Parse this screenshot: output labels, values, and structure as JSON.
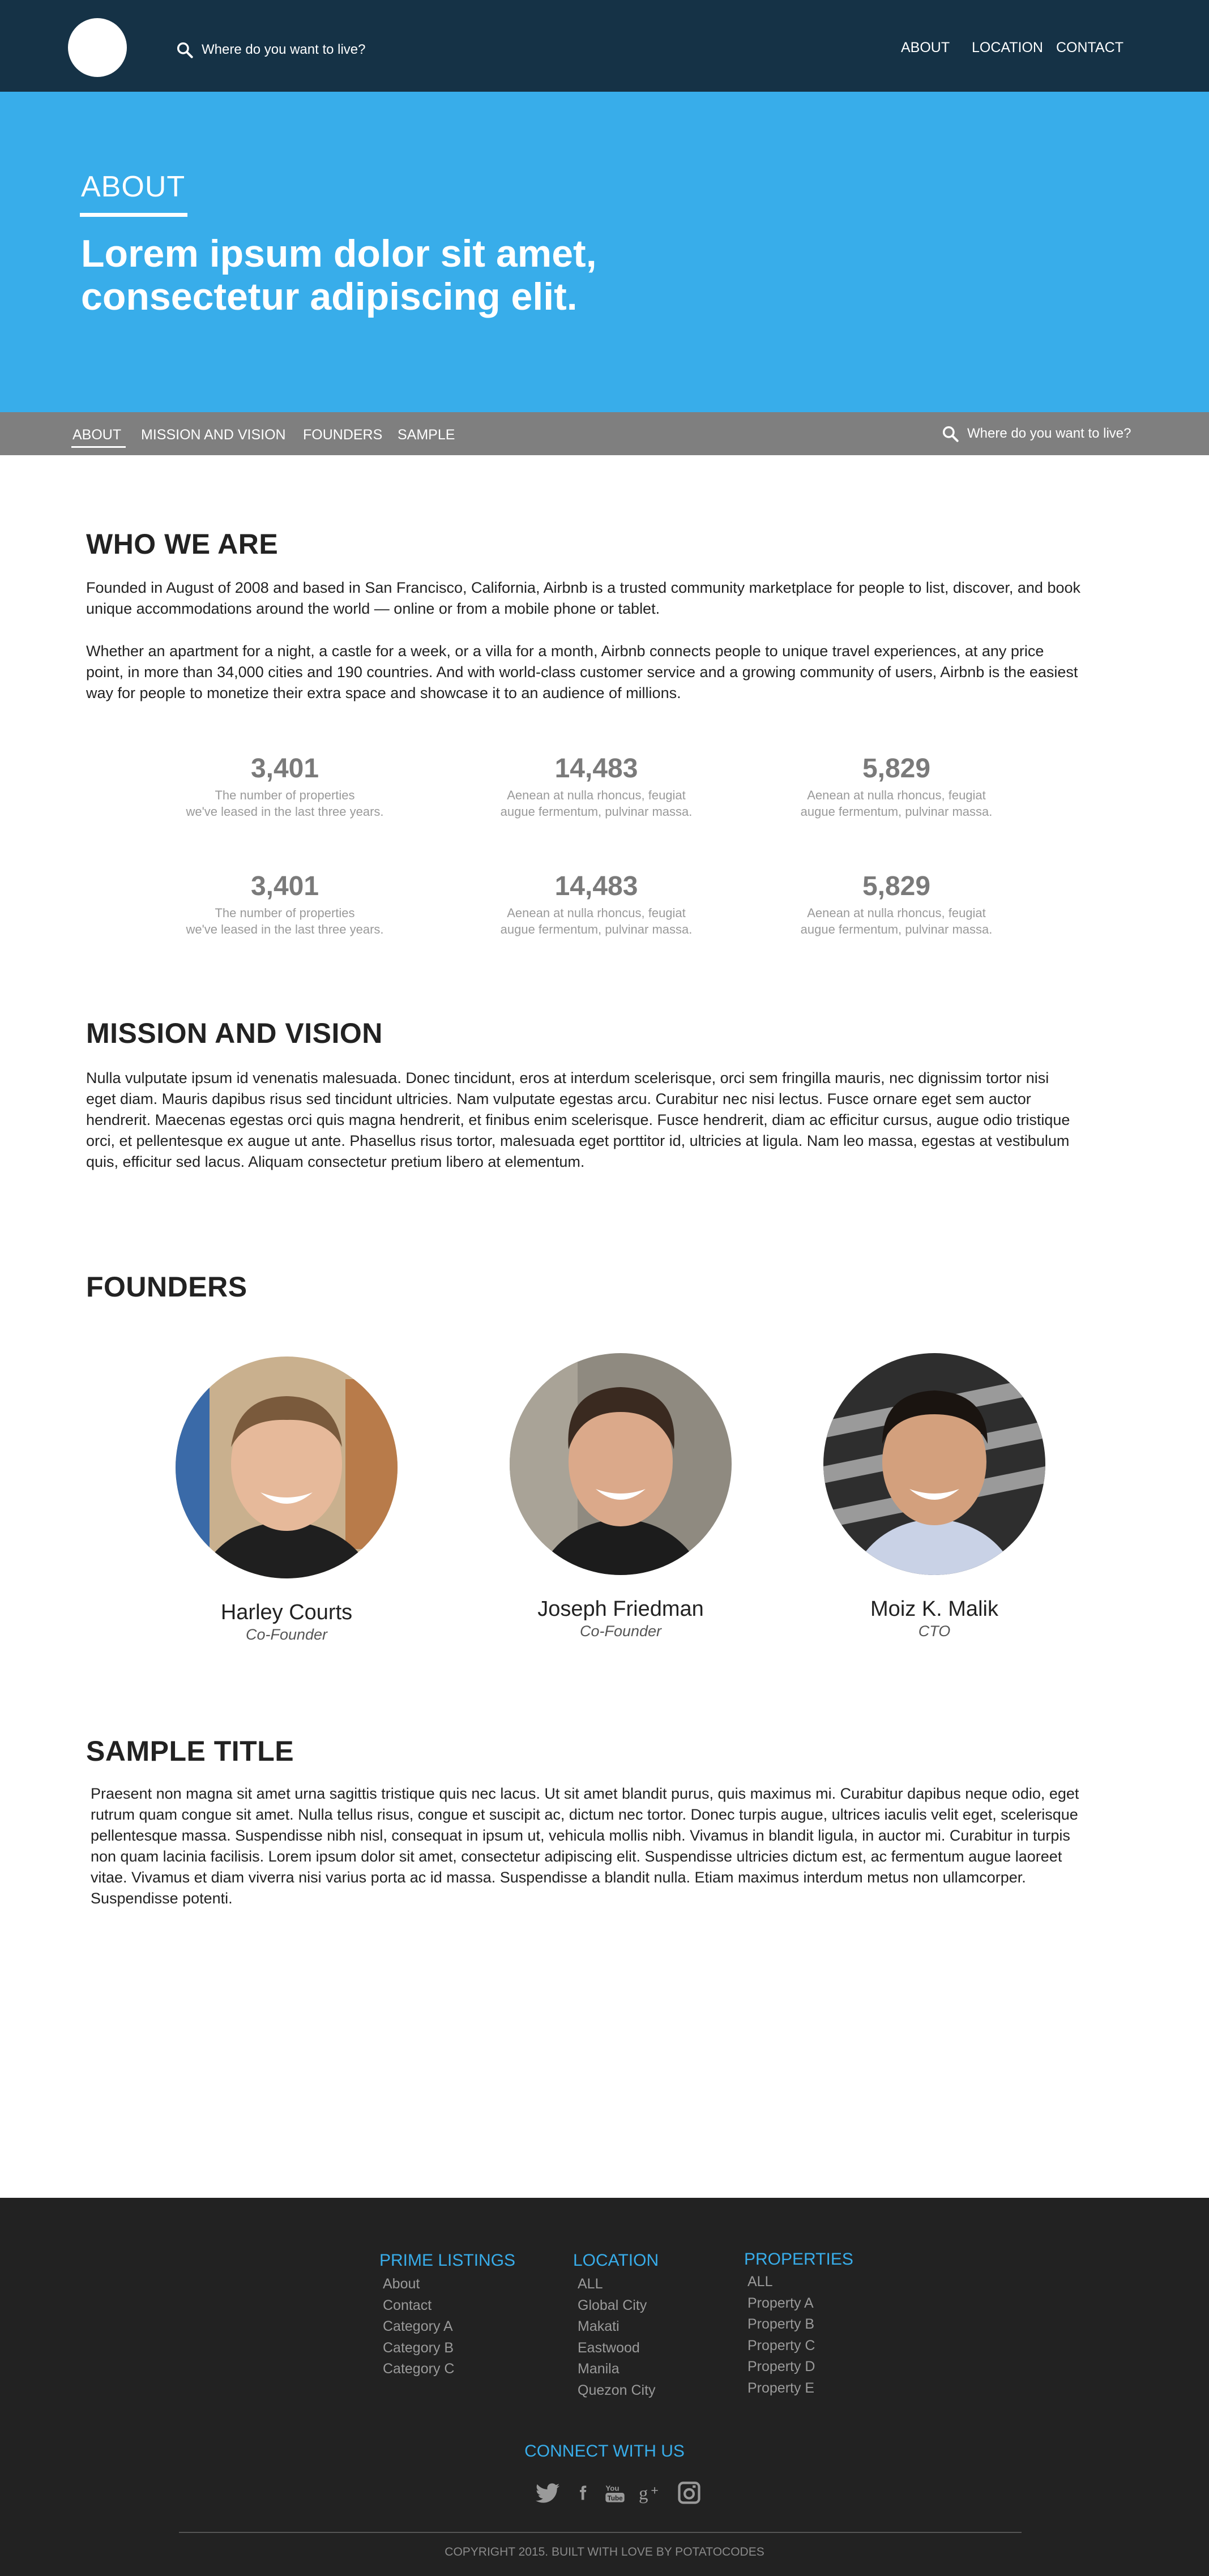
{
  "top_nav": {
    "search_placeholder": "Where do you want to live?",
    "links": [
      "ABOUT",
      "LOCATION",
      "CONTACT"
    ]
  },
  "hero": {
    "kicker": "ABOUT",
    "title_line1": "Lorem ipsum dolor sit amet,",
    "title_line2": "consectetur adipiscing elit."
  },
  "sub_nav": {
    "links": [
      "ABOUT",
      "MISSION AND VISION",
      "FOUNDERS",
      "SAMPLE"
    ],
    "search_placeholder": "Where do you want to live?"
  },
  "who_we_are": {
    "title": "WHO WE ARE",
    "paragraphs": [
      "Founded in August of 2008 and based in San Francisco, California, Airbnb is a trusted community marketplace for people to list, discover, and book unique accommodations around the world — online or from a mobile phone or tablet.",
      "Whether an apartment for a night, a castle for a week, or a villa for a month, Airbnb connects people to unique travel experiences, at any price point, in more than 34,000 cities and 190 countries. And with world-class customer service and a growing community of users, Airbnb is the easiest way for people to monetize their extra space and showcase it to an audience of millions."
    ],
    "stats": [
      {
        "value": "3,401",
        "line1": "The number of properties",
        "line2": "we've leased in the last three years."
      },
      {
        "value": "14,483",
        "line1": "Aenean at nulla rhoncus, feugiat",
        "line2": "augue fermentum, pulvinar massa."
      },
      {
        "value": "5,829",
        "line1": "Aenean at nulla rhoncus, feugiat",
        "line2": "augue fermentum, pulvinar massa."
      },
      {
        "value": "3,401",
        "line1": "The number of properties",
        "line2": "we've leased in the last three years."
      },
      {
        "value": "14,483",
        "line1": "Aenean at nulla rhoncus, feugiat",
        "line2": "augue fermentum, pulvinar massa."
      },
      {
        "value": "5,829",
        "line1": "Aenean at nulla rhoncus, feugiat",
        "line2": "augue fermentum, pulvinar massa."
      }
    ]
  },
  "mission": {
    "title": "MISSION AND VISION",
    "text": "Nulla vulputate ipsum id venenatis malesuada. Donec tincidunt, eros at interdum scelerisque, orci sem fringilla mauris, nec dignissim tortor nisi eget diam. Mauris dapibus risus sed tincidunt ultricies. Nam vulputate egestas arcu. Curabitur nec nisi lectus. Fusce ornare eget sem auctor hendrerit. Maecenas egestas orci quis magna hendrerit, et finibus enim scelerisque. Fusce hendrerit, diam ac efficitur cursus, augue odio tristique orci, et pellentesque ex augue ut ante. Phasellus risus tortor, malesuada eget porttitor id, ultricies at ligula. Nam leo massa, egestas at vestibulum quis, efficitur sed lacus. Aliquam consectetur pretium libero at elementum."
  },
  "founders": {
    "title": "FOUNDERS",
    "people": [
      {
        "name": "Harley Courts",
        "role": "Co-Founder"
      },
      {
        "name": "Joseph Friedman",
        "role": "Co-Founder"
      },
      {
        "name": "Moiz K. Malik",
        "role": "CTO"
      }
    ]
  },
  "sample": {
    "title": "SAMPLE TITLE",
    "text": "Praesent non magna sit amet urna sagittis tristique quis nec lacus. Ut sit amet blandit purus, quis maximus mi. Curabitur dapibus neque odio, eget rutrum quam congue sit amet. Nulla tellus risus, congue et suscipit ac, dictum nec tortor. Donec turpis augue, ultrices iaculis velit eget, scelerisque pellentesque massa. Suspendisse nibh nisl, consequat in ipsum ut, vehicula mollis nibh. Vivamus in blandit ligula, in auctor mi. Curabitur in turpis non quam lacinia facilisis. Lorem ipsum dolor sit amet, consectetur adipiscing elit. Suspendisse ultricies dictum est, ac fermentum augue laoreet vitae. Vivamus et diam viverra nisi varius porta ac id massa. Suspendisse a blandit nulla. Etiam maximus interdum metus non ullamcorper. Suspendisse potenti."
  },
  "footer": {
    "columns": [
      {
        "heading": "PRIME LISTINGS",
        "links": [
          "About",
          "Contact",
          "Category A",
          "Category B",
          "Category C"
        ]
      },
      {
        "heading": "LOCATION",
        "links": [
          "ALL",
          "Global City",
          "Makati",
          "Eastwood",
          "Manila",
          "Quezon City"
        ]
      },
      {
        "heading": "PROPERTIES",
        "links": [
          "ALL",
          "Property A",
          "Property B",
          "Property C",
          "Property D",
          "Property E"
        ]
      }
    ],
    "connect_heading": "CONNECT WITH US",
    "social_icons": [
      "twitter-icon",
      "facebook-icon",
      "youtube-icon",
      "google-plus-icon",
      "instagram-icon"
    ],
    "copyright": "COPYRIGHT 2015. BUILT WITH LOVE BY POTATOCODES"
  },
  "colors": {
    "nav_bg": "#153246",
    "hero_bg": "#38adea",
    "subnav_bg": "#7f7f7f",
    "footer_bg": "#222222",
    "accent": "#38adea"
  }
}
